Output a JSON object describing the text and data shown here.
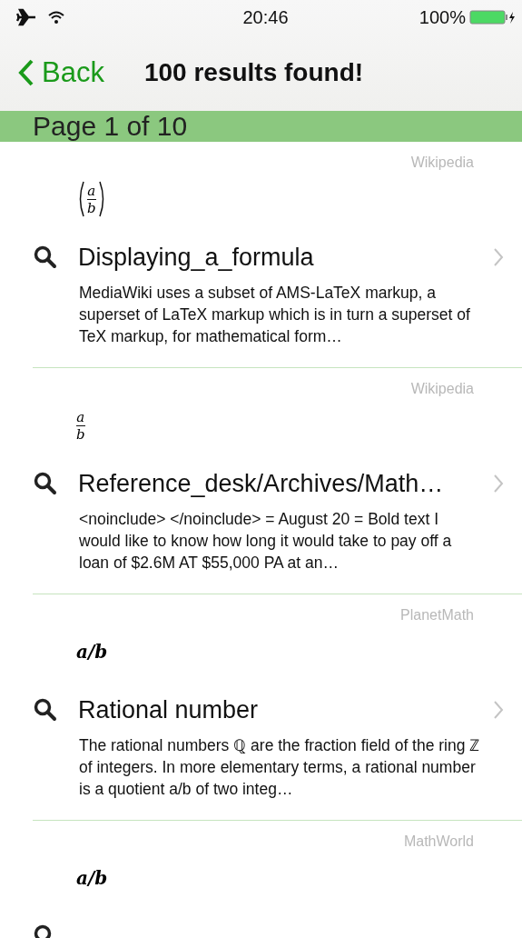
{
  "status_bar": {
    "time": "20:46",
    "battery": "100%"
  },
  "nav_bar": {
    "back": "Back",
    "title": "100 results found!"
  },
  "page_header": "Page 1 of 10",
  "results": [
    {
      "source": "Wikipedia",
      "formula": {
        "kind": "paren_fraction",
        "numerator": "a",
        "denominator": "b"
      },
      "title": "Displaying_a_formula",
      "snippet": "MediaWiki uses a subset of AMS-LaTeX markup, a superset of LaTeX markup which is in turn a superset of TeX markup, for mathematical form…"
    },
    {
      "source": "Wikipedia",
      "formula": {
        "kind": "fraction",
        "numerator": "a",
        "denominator": "b"
      },
      "title": "Reference_desk/Archives/Math…",
      "snippet": "<noinclude> </noinclude> = August 20 = Bold text I would like to know how long it would take to pay off a loan of $2.6M AT $55,000 PA at an…"
    },
    {
      "source": "PlanetMath",
      "formula": {
        "kind": "inline",
        "text": "a/b"
      },
      "title": "Rational number",
      "snippet": "The rational numbers ℚ are the fraction field of the ring ℤ of integers. In more elementary terms, a rational number is a quotient a/b of two integ…"
    },
    {
      "source": "MathWorld",
      "formula": {
        "kind": "inline",
        "text": "a/b"
      }
    }
  ]
}
